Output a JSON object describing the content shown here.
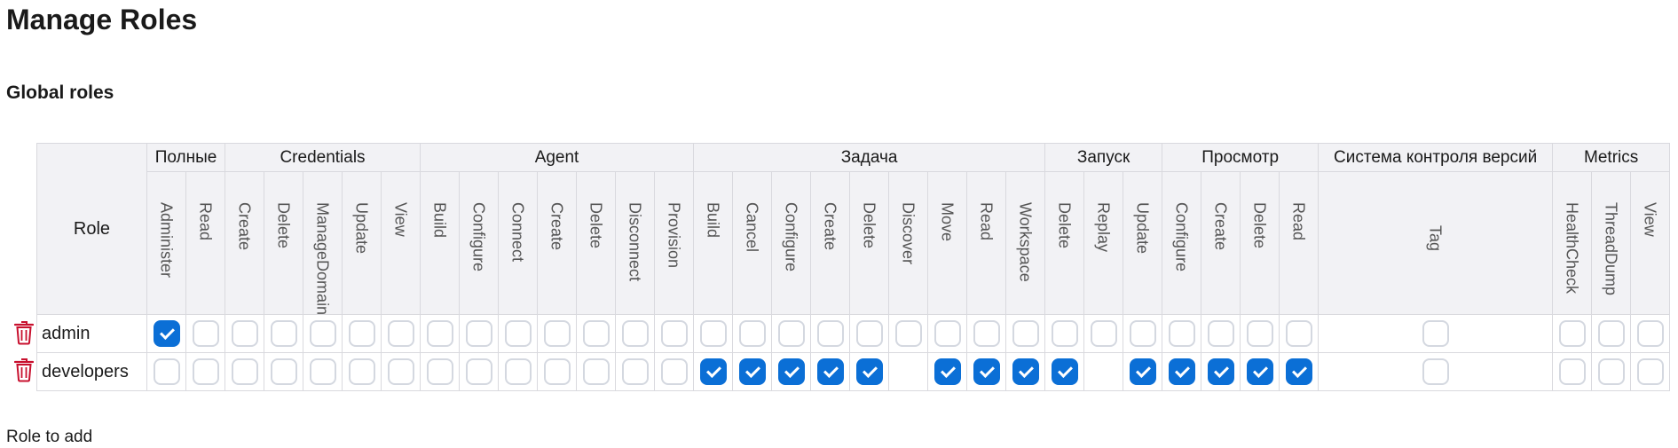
{
  "page": {
    "title": "Manage Roles",
    "section_title": "Global roles",
    "role_to_add_label": "Role to add"
  },
  "table": {
    "role_header": "Role",
    "groups": [
      {
        "label": "Полные",
        "perms": [
          "Administer",
          "Read"
        ]
      },
      {
        "label": "Credentials",
        "perms": [
          "Create",
          "Delete",
          "ManageDomains",
          "Update",
          "View"
        ]
      },
      {
        "label": "Agent",
        "perms": [
          "Build",
          "Configure",
          "Connect",
          "Create",
          "Delete",
          "Disconnect",
          "Provision"
        ]
      },
      {
        "label": "Задача",
        "perms": [
          "Build",
          "Cancel",
          "Configure",
          "Create",
          "Delete",
          "Discover",
          "Move",
          "Read",
          "Workspace"
        ]
      },
      {
        "label": "Запуск",
        "perms": [
          "Delete",
          "Replay",
          "Update"
        ]
      },
      {
        "label": "Просмотр",
        "perms": [
          "Configure",
          "Create",
          "Delete",
          "Read"
        ]
      },
      {
        "label": "Система контроля версий",
        "perms": [
          "Tag"
        ]
      },
      {
        "label": "Metrics",
        "perms": [
          "HealthCheck",
          "ThreadDump",
          "View"
        ]
      }
    ],
    "rows": [
      {
        "name": "admin",
        "checks": [
          1,
          0,
          0,
          0,
          0,
          0,
          0,
          0,
          0,
          0,
          0,
          0,
          0,
          0,
          0,
          0,
          0,
          0,
          0,
          0,
          0,
          0,
          0,
          0,
          0,
          0,
          0,
          0,
          0,
          0,
          0,
          0,
          0,
          0
        ],
        "hidden": [
          0,
          0,
          0,
          0,
          0,
          0,
          0,
          0,
          0,
          0,
          0,
          0,
          0,
          0,
          0,
          0,
          0,
          0,
          0,
          0,
          0,
          0,
          0,
          0,
          0,
          0,
          0,
          0,
          0,
          0,
          0,
          0,
          0,
          0
        ]
      },
      {
        "name": "developers",
        "checks": [
          0,
          0,
          0,
          0,
          0,
          0,
          0,
          0,
          0,
          0,
          0,
          0,
          0,
          0,
          1,
          1,
          1,
          1,
          1,
          0,
          1,
          1,
          1,
          1,
          0,
          1,
          1,
          1,
          1,
          1,
          0,
          0,
          0,
          0
        ],
        "hidden": [
          0,
          0,
          0,
          0,
          0,
          0,
          0,
          0,
          0,
          0,
          0,
          0,
          0,
          0,
          0,
          0,
          0,
          0,
          0,
          1,
          0,
          0,
          0,
          0,
          1,
          0,
          0,
          0,
          0,
          0,
          0,
          0,
          0,
          0
        ]
      }
    ]
  },
  "icons": {
    "delete": "trash-icon"
  },
  "colors": {
    "checked": "#0b6fd6",
    "delete": "#c8102e",
    "header_bg": "#f2f2f5"
  }
}
